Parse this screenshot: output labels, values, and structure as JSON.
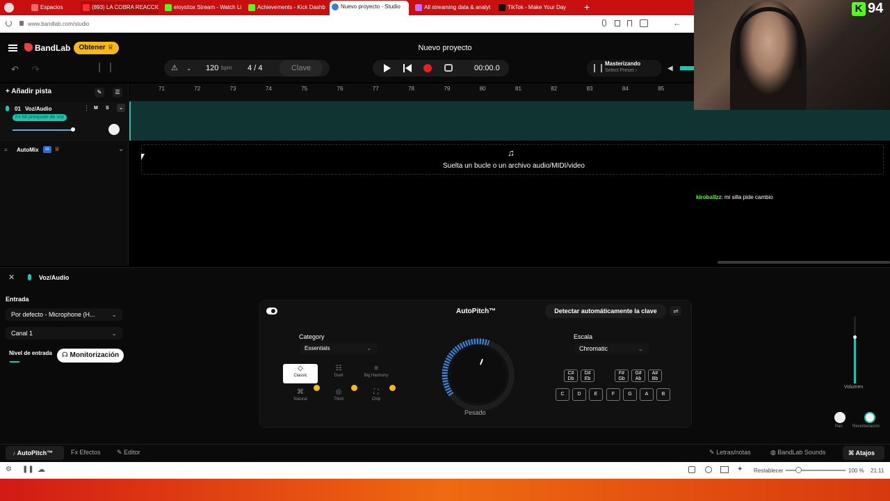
{
  "browser": {
    "tabs": [
      {
        "label": "Espacios",
        "color": "#d94444"
      },
      {
        "label": "(893) LA COBRA REACCIONA",
        "color": "#ff2a2a"
      },
      {
        "label": "eloysitox Stream - Watch Li",
        "color": "#53fc18"
      },
      {
        "label": "Achievements - Kick Dashb",
        "color": "#53fc18"
      },
      {
        "label": "Nuevo proyecto - Studio",
        "color": "#3a7bd5"
      },
      {
        "label": "All streaming data & analyt",
        "color": "#c070ff"
      },
      {
        "label": "TikTok - Make Your Day",
        "color": "#111111"
      }
    ],
    "url": "www.bandlab.com/studio"
  },
  "header": {
    "brand": "BandLab",
    "get_button": "Obtener",
    "project_title": "Nuevo proyecto",
    "bpm_value": "120",
    "bpm_unit": "bpm",
    "time_sig_top": "4",
    "time_sig_sep": "/",
    "time_sig_bottom": "4",
    "key_label": "Clave",
    "time": "00:00.0",
    "mastering_title": "Masterizando",
    "mastering_sub": "Select Preset ›"
  },
  "tracks": {
    "add_track": "Añadir pista",
    "track_number": "01",
    "track_name": "Voz/Audio",
    "mute": "M",
    "solo": "S",
    "fx_preset": "Fx Mi preajuste de voz",
    "automix": "AutoMix",
    "automix_badge": "IA"
  },
  "ruler": {
    "bars": [
      "71",
      "72",
      "73",
      "74",
      "75",
      "76",
      "77",
      "78",
      "79",
      "80",
      "81",
      "82",
      "83",
      "84",
      "85",
      "8"
    ]
  },
  "dropzone": {
    "text": "Suelta un bucle o un archivo audio/MIDI/video"
  },
  "chat": {
    "user": "kiroballzz",
    "message": ": mi silla pide cambio"
  },
  "panel": {
    "track_title": "Voz/Audio",
    "input_label": "Entrada",
    "input_device": "Por defecto - Microphone (H...",
    "channel": "Canal 1",
    "input_level": "Nivel de entrada",
    "monitor_button": "Monitorización",
    "autopitch_title": "AutoPitch™",
    "detect_key_button": "Detectar automáticamente la clave",
    "category_label": "Category",
    "category_value": "Essentials",
    "modes": [
      "Classic",
      "Duet",
      "Big Harmony",
      "Natural",
      "Third",
      "Chip"
    ],
    "knob_label": "Pesado",
    "scale_label": "Escala",
    "scale_value": "Chromatic",
    "sharp_keys": [
      "C#\nDb",
      "D#\nEb",
      "F#\nGb",
      "G#\nAb",
      "A#\nBb"
    ],
    "natural_keys": [
      "C",
      "D",
      "E",
      "F",
      "G",
      "A",
      "B"
    ],
    "volume_label": "Volumen",
    "pan_label": "Pan",
    "reverb_label": "Reverberación"
  },
  "bottomnav": {
    "autopitch": "AutoPitch™",
    "effects": "Efectos",
    "editor": "Editor",
    "lyrics": "Letras/notas",
    "sounds": "BandLab Sounds",
    "shortcuts": "Atajos"
  },
  "statusbar": {
    "reset": "Restablecer",
    "zoom": "100 %",
    "clock": "21:11"
  },
  "webcam": {
    "kick_letter": "K",
    "viewer_count": "94"
  },
  "colors": {
    "accent_teal": "#21c4b4",
    "record_red": "#e62020",
    "brand_red": "#f0403a",
    "get_yellow": "#f7b916"
  }
}
